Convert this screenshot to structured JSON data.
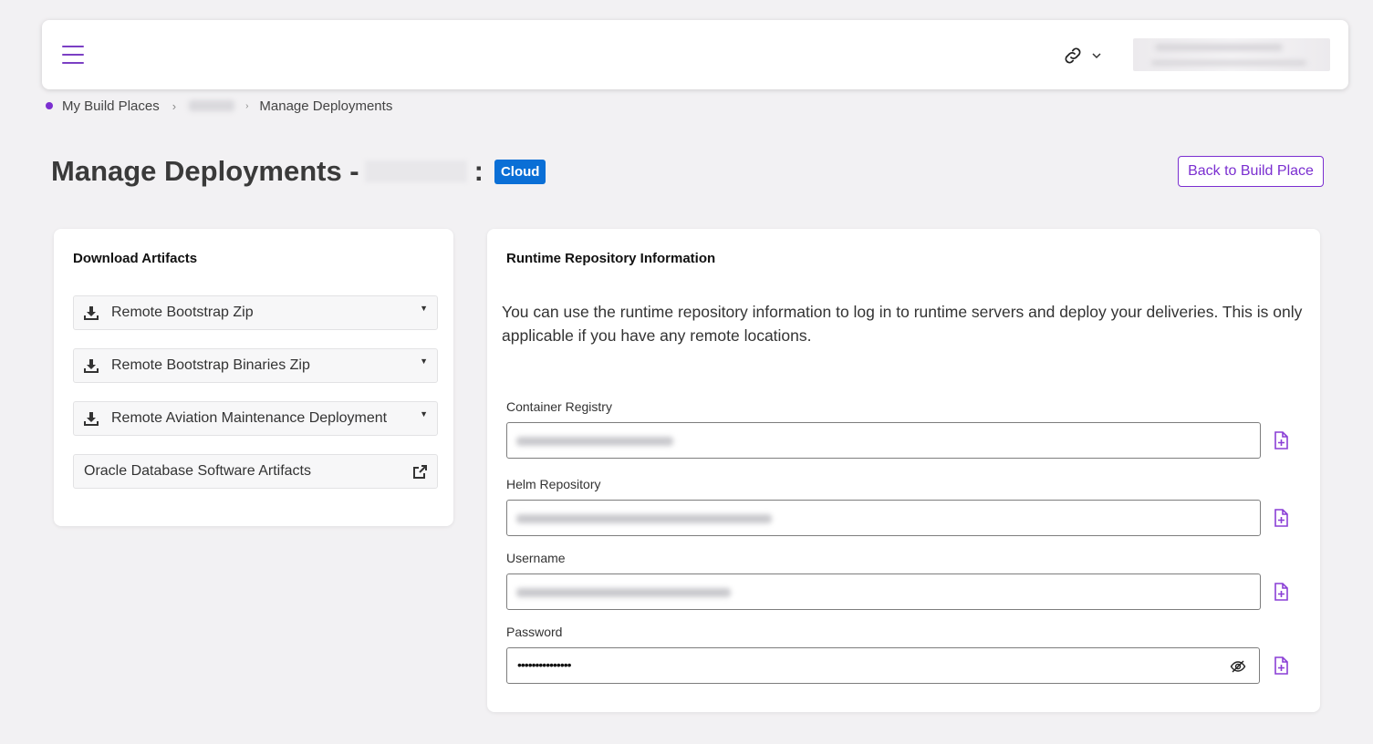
{
  "header": {
    "menu_icon": "hamburger-icon",
    "link_icon": "link-icon",
    "chevron_icon": "chevron-down-icon"
  },
  "breadcrumb": {
    "items": [
      "My Build Places",
      "Manage Deployments"
    ]
  },
  "page": {
    "title": "Manage Deployments -",
    "colon": ":",
    "badge": "Cloud",
    "back_button": "Back to Build Place"
  },
  "download": {
    "title": "Download Artifacts",
    "items": [
      {
        "label": "Remote Bootstrap Zip",
        "icon": "download-icon"
      },
      {
        "label": "Remote Bootstrap Binaries Zip",
        "icon": "download-icon"
      },
      {
        "label": "Remote Aviation Maintenance Deployment",
        "icon": "download-icon"
      },
      {
        "label": "Oracle Database Software Artifacts",
        "icon": "external-link-icon"
      }
    ]
  },
  "runtime": {
    "title": "Runtime Repository Information",
    "description": "You can use the runtime repository information to log in to runtime servers and deploy your deliveries. This is only applicable if you have any remote locations.",
    "fields": [
      {
        "label": "Container Registry"
      },
      {
        "label": "Helm Repository"
      },
      {
        "label": "Username"
      },
      {
        "label": "Password",
        "value": "•••••••••••••••"
      }
    ]
  },
  "colors": {
    "accent": "#7b2fd0",
    "badge": "#0a6fd6",
    "background": "#f2f1f3"
  }
}
